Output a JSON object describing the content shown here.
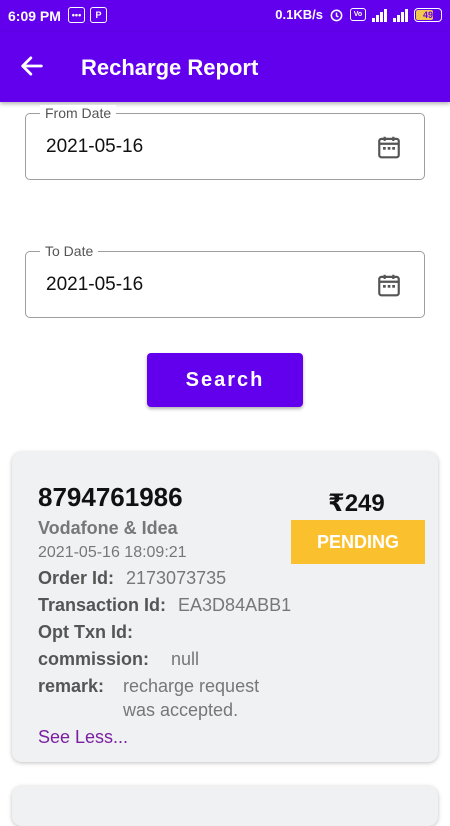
{
  "status_bar": {
    "time": "6:09 PM",
    "network_speed": "0.1KB/s",
    "battery": "49",
    "network_type": "4G"
  },
  "app_bar": {
    "title": "Recharge Report",
    "back_icon": "arrow-left-icon"
  },
  "form": {
    "from_date": {
      "label": "From Date",
      "value": "2021-05-16"
    },
    "to_date": {
      "label": "To Date",
      "value": "2021-05-16"
    },
    "search_label": "Search"
  },
  "transaction": {
    "mobile": "8794761986",
    "amount": "₹249",
    "status": "PENDING",
    "operator": "Vodafone  & Idea",
    "datetime": "2021-05-16 18:09:21",
    "order_id_label": "Order Id:",
    "order_id": "2173073735",
    "transaction_id_label": "Transaction Id:",
    "transaction_id": "EA3D84ABB1",
    "opt_txn_id_label": "Opt Txn Id:",
    "opt_txn_id": "",
    "commission_label": "commission:",
    "commission": "null",
    "remark_label": "remark:",
    "remark": "recharge request was accepted.",
    "see_less": "See Less..."
  },
  "colors": {
    "primary": "#6200ee",
    "pending": "#fbc02d",
    "link": "#7b1fa2"
  }
}
